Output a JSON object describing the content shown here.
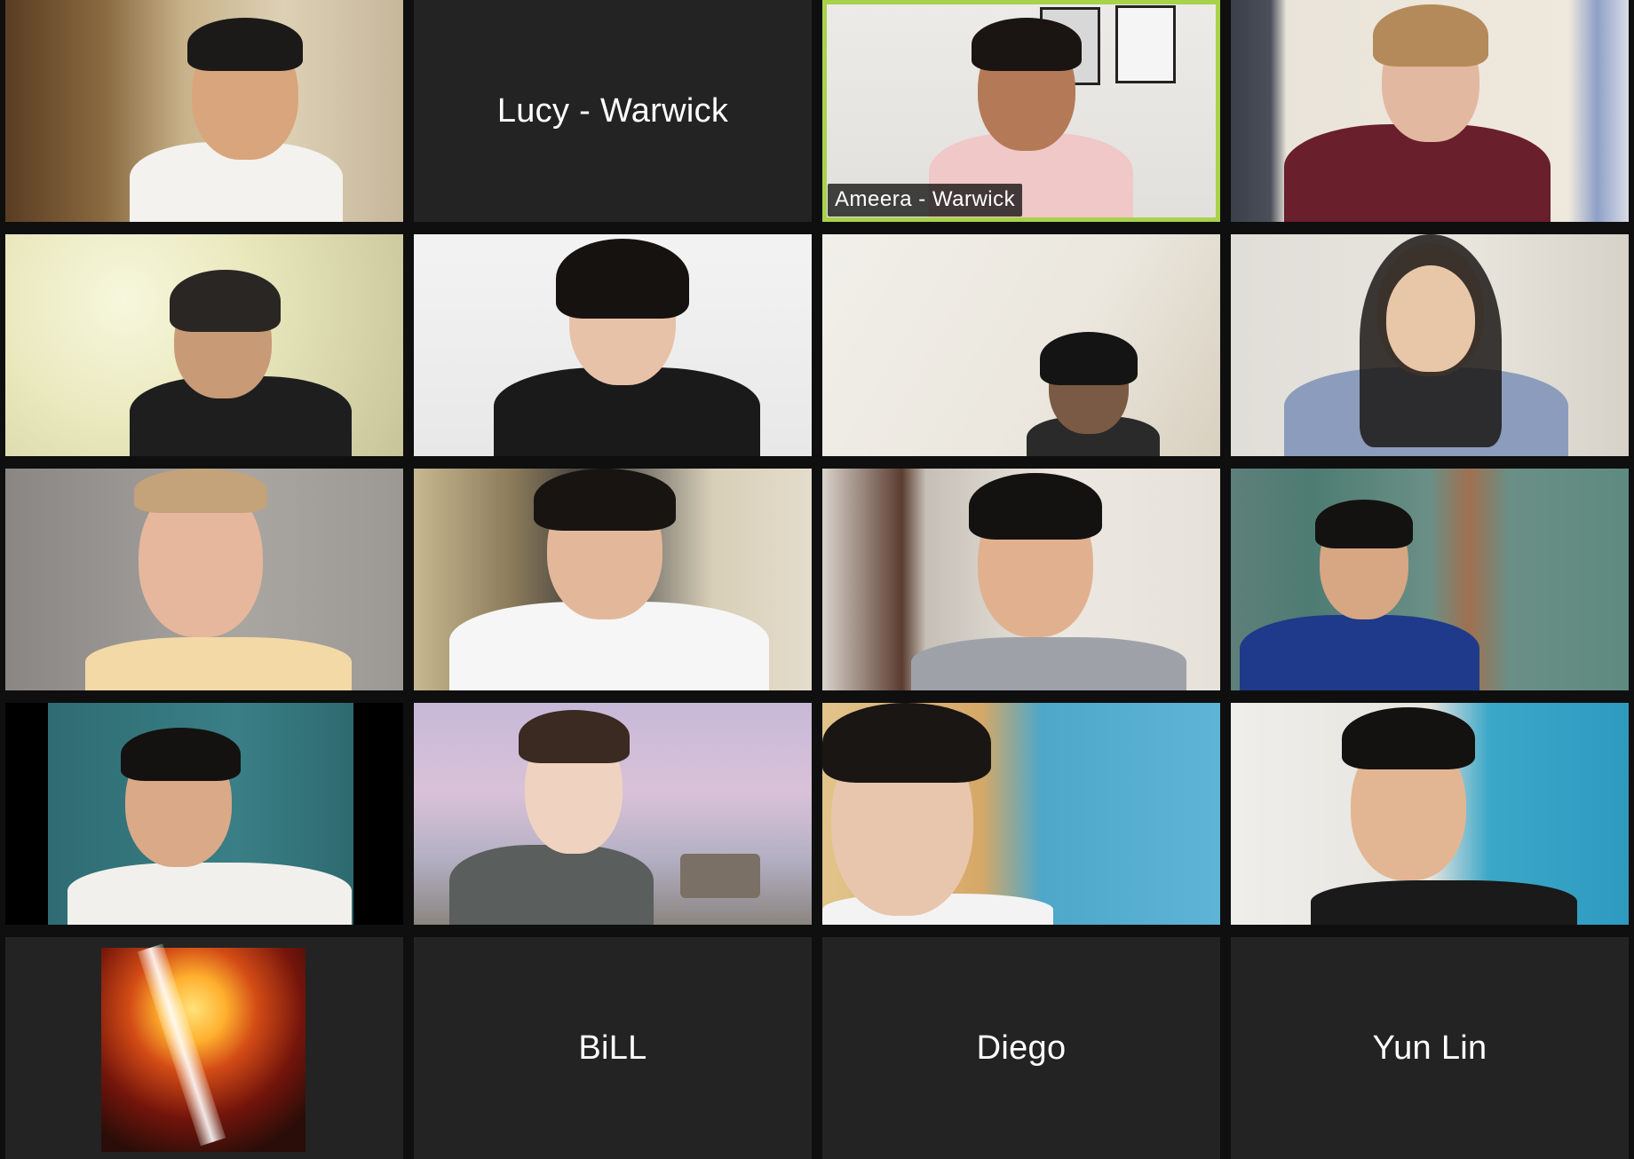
{
  "meeting": {
    "participants": [
      {
        "id": "p1",
        "type": "video",
        "label": ""
      },
      {
        "id": "p2",
        "type": "name",
        "label": "Lucy - Warwick"
      },
      {
        "id": "p3",
        "type": "video",
        "label": "Ameera - Warwick",
        "speaking": true
      },
      {
        "id": "p4",
        "type": "video",
        "label": ""
      },
      {
        "id": "p5",
        "type": "video",
        "label": ""
      },
      {
        "id": "p6",
        "type": "video",
        "label": ""
      },
      {
        "id": "p7",
        "type": "video",
        "label": ""
      },
      {
        "id": "p8",
        "type": "video",
        "label": ""
      },
      {
        "id": "p9",
        "type": "video",
        "label": ""
      },
      {
        "id": "p10",
        "type": "video",
        "label": ""
      },
      {
        "id": "p11",
        "type": "video",
        "label": ""
      },
      {
        "id": "p12",
        "type": "video",
        "label": ""
      },
      {
        "id": "p13",
        "type": "video",
        "label": ""
      },
      {
        "id": "p14",
        "type": "video",
        "label": ""
      },
      {
        "id": "p15",
        "type": "video",
        "label": ""
      },
      {
        "id": "p16",
        "type": "video",
        "label": ""
      },
      {
        "id": "p17",
        "type": "avatar",
        "label": ""
      },
      {
        "id": "p18",
        "type": "name",
        "label": "BiLL"
      },
      {
        "id": "p19",
        "type": "name",
        "label": "Diego"
      },
      {
        "id": "p20",
        "type": "name",
        "label": "Yun Lin"
      }
    ],
    "active_speaker_color": "#a8d24a",
    "tile_bg_color": "#232323"
  }
}
